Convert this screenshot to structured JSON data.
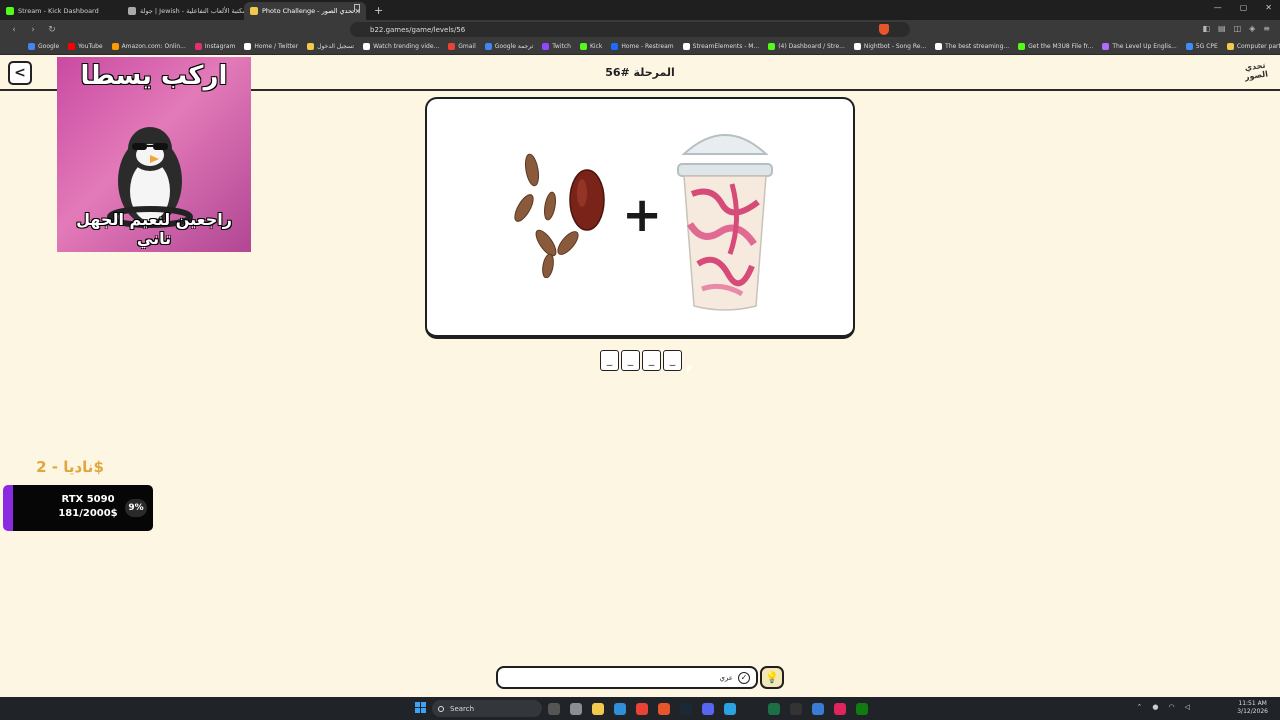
{
  "browser": {
    "tabs": [
      {
        "label": "Stream - Kick Dashboard",
        "color": "#53fc18"
      },
      {
        "label": "جولة | Jewish - مكتبة الألعاب التفاعلية",
        "color": "#aaaaaa"
      },
      {
        "label": "Photo Challenge - تحدي الصور",
        "color": "#f2c94c",
        "active": true
      }
    ],
    "new_tab": "+",
    "url": "b22.games/game/levels/56",
    "bookmarks": [
      {
        "label": "Google",
        "color": "#4285f4"
      },
      {
        "label": "YouTube",
        "color": "#ff0000"
      },
      {
        "label": "Amazon.com: Onlin...",
        "color": "#ff9900"
      },
      {
        "label": "Instagram",
        "color": "#e1306c"
      },
      {
        "label": "Home / Twitter",
        "color": "#ffffff"
      },
      {
        "label": "تسجيل الدخول",
        "color": "#f2c94c"
      },
      {
        "label": "Watch trending vide...",
        "color": "#ffffff"
      },
      {
        "label": "Gmail",
        "color": "#ea4335"
      },
      {
        "label": "Google ترجمة",
        "color": "#4285f4"
      },
      {
        "label": "Twitch",
        "color": "#9146ff"
      },
      {
        "label": "Kick",
        "color": "#53fc18"
      },
      {
        "label": "Home - Restream",
        "color": "#1e6bff"
      },
      {
        "label": "StreamElements - M...",
        "color": "#ffffff"
      },
      {
        "label": "(4) Dashboard / Stre...",
        "color": "#53fc18"
      },
      {
        "label": "Nightbot - Song Re...",
        "color": "#ffffff"
      },
      {
        "label": "The best streaming...",
        "color": "#ffffff"
      },
      {
        "label": "Get the M3U8 File fr...",
        "color": "#53fc18"
      },
      {
        "label": "The Level Up Englis...",
        "color": "#b26bff"
      },
      {
        "label": "5G CPE",
        "color": "#3f8cff"
      },
      {
        "label": "Computer parts, lap...",
        "color": "#f2c94c"
      }
    ]
  },
  "app": {
    "back_icon": "chevron-left-icon",
    "back_glyph": "<",
    "level_title": "المرحلة #56",
    "logo_text": "تحدي الصور"
  },
  "meme": {
    "top_text": "اركب يسطا",
    "bottom_text": "راجعين لنعيم الجهل تاني"
  },
  "puzzle": {
    "plus": "+",
    "slots": [
      "_",
      "_",
      "_",
      "_"
    ]
  },
  "donation": {
    "donor": "ناديا - 2$",
    "goal_name": "RTX 5090",
    "goal_amount": "181/2000$",
    "goal_percent": "9%",
    "goal_progress": 0.09,
    "accent": "#8a2be2"
  },
  "answer": {
    "value": "عري",
    "submit_icon": "check-icon",
    "submit_glyph": "✓",
    "hint_icon": "lightbulb-icon",
    "hint_glyph": "💡"
  },
  "taskbar": {
    "search_placeholder": "Search",
    "time": "11:51 AM",
    "date": "3/12/2026"
  }
}
